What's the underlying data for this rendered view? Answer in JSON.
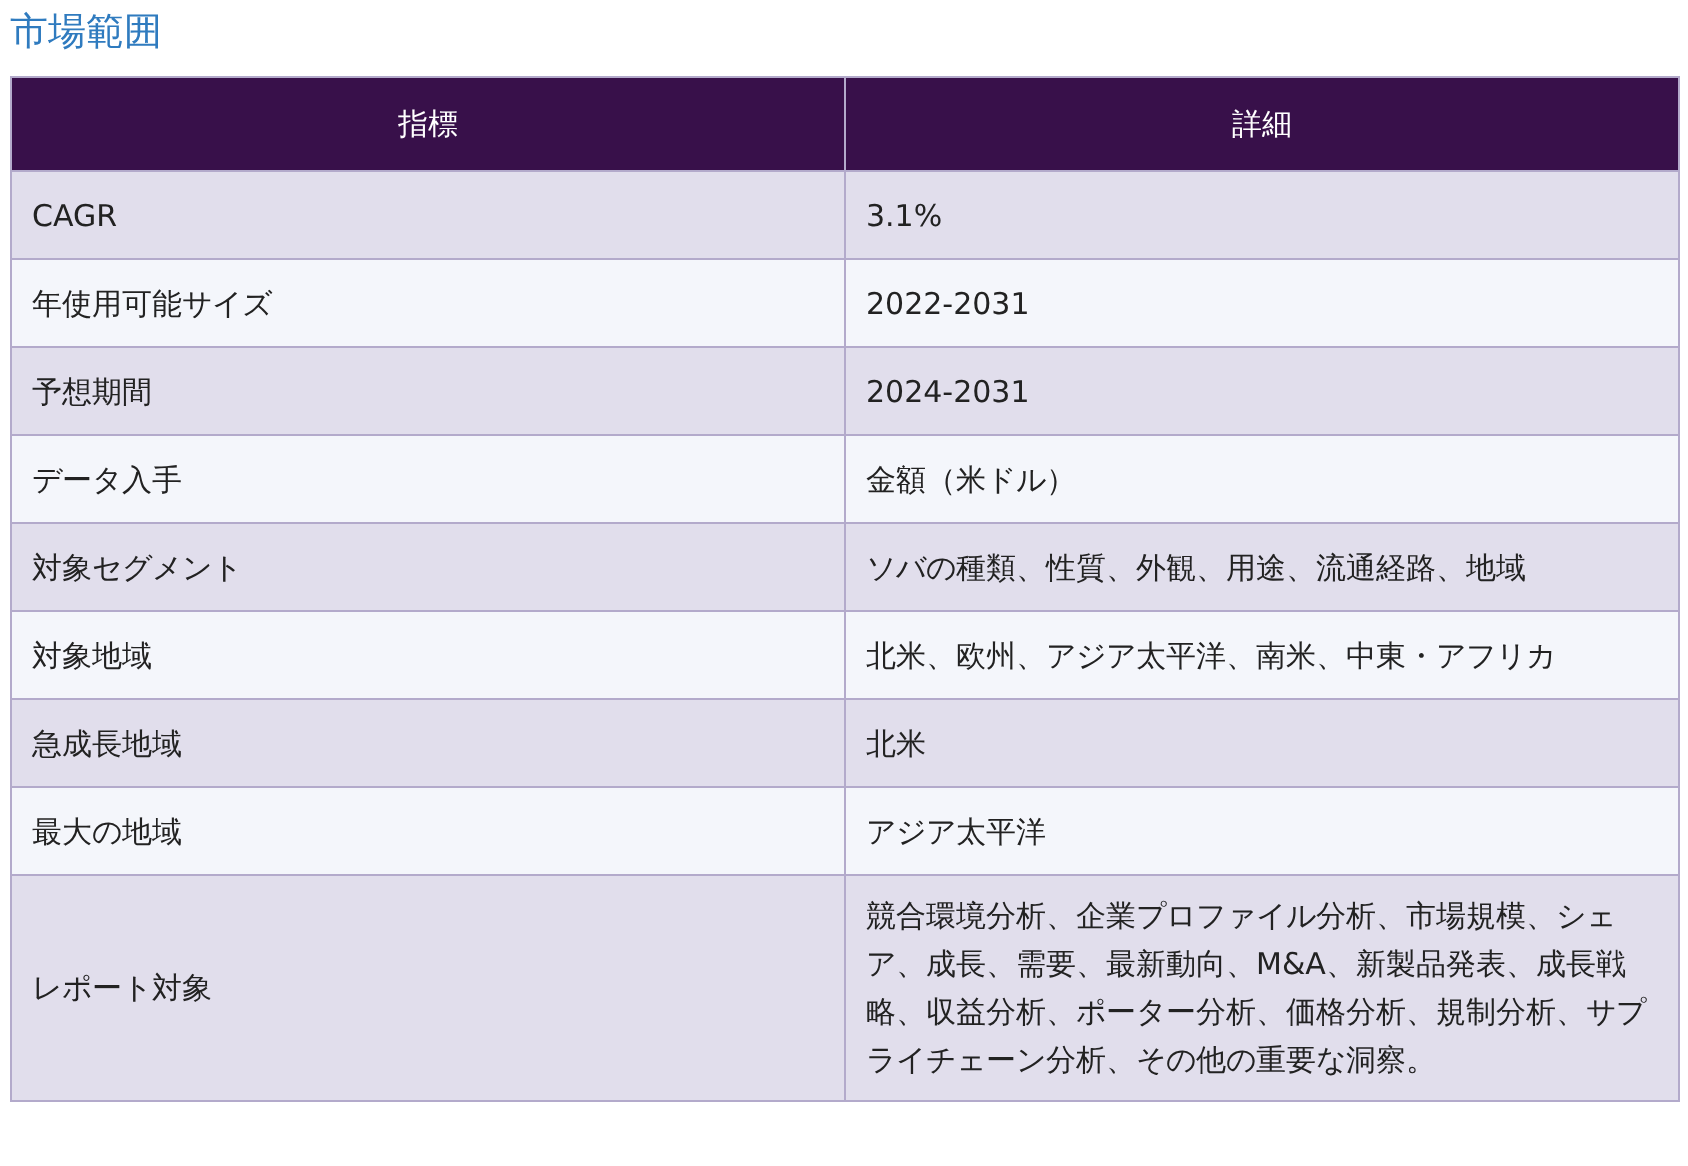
{
  "title": "市場範囲",
  "table": {
    "columns": [
      "指標",
      "詳細"
    ],
    "rows": [
      [
        "CAGR",
        "3.1%"
      ],
      [
        "年使用可能サイズ",
        "2022-2031"
      ],
      [
        "予想期間",
        "2024-2031"
      ],
      [
        "データ入手",
        "金額（米ドル）"
      ],
      [
        "対象セグメント",
        "ソバの種類、性質、外観、用途、流通経路、地域"
      ],
      [
        "対象地域",
        "北米、欧州、アジア太平洋、南米、中東・アフリカ"
      ],
      [
        "急成長地域",
        "北米"
      ],
      [
        "最大の地域",
        "アジア太平洋"
      ],
      [
        "レポート対象",
        "競合環境分析、企業プロファイル分析、市場規模、シェア、成長、需要、最新動向、M&A、新製品発表、成長戦略、収益分析、ポーター分析、価格分析、規制分析、サプライチェーン分析、その他の重要な洞察。"
      ]
    ]
  }
}
